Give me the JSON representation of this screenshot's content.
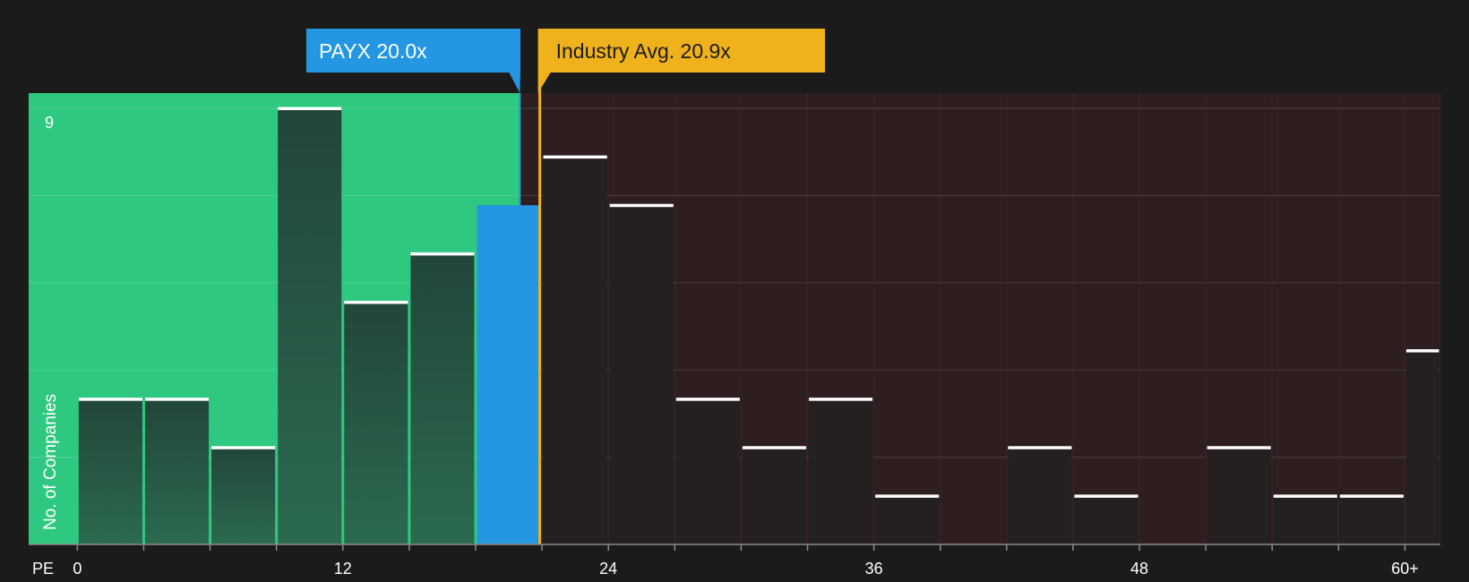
{
  "chart_data": {
    "type": "bar",
    "x_axis_prefix": "PE",
    "xlabel": "",
    "ylabel": "No. of Companies",
    "x_ticks": [
      "0",
      "12",
      "24",
      "36",
      "48",
      "60+"
    ],
    "x_tick_values": [
      0,
      12,
      24,
      36,
      48,
      60
    ],
    "y_tick_labels": [
      "9"
    ],
    "xlim": [
      -2.2,
      61.6
    ],
    "ylim": [
      0,
      9.3
    ],
    "bin_width": 3,
    "bins": [
      {
        "start": 0,
        "count": 3
      },
      {
        "start": 3,
        "count": 3
      },
      {
        "start": 6,
        "count": 2
      },
      {
        "start": 9,
        "count": 9
      },
      {
        "start": 12,
        "count": 5
      },
      {
        "start": 15,
        "count": 6
      },
      {
        "start": 18,
        "count": 7
      },
      {
        "start": 21,
        "count": 8
      },
      {
        "start": 24,
        "count": 7
      },
      {
        "start": 27,
        "count": 3
      },
      {
        "start": 30,
        "count": 2
      },
      {
        "start": 33,
        "count": 3
      },
      {
        "start": 36,
        "count": 1
      },
      {
        "start": 39,
        "count": 0
      },
      {
        "start": 42,
        "count": 2
      },
      {
        "start": 45,
        "count": 1
      },
      {
        "start": 48,
        "count": 0
      },
      {
        "start": 51,
        "count": 2
      },
      {
        "start": 54,
        "count": 1
      },
      {
        "start": 57,
        "count": 1
      },
      {
        "start": 60,
        "count": 4
      }
    ],
    "highlight_bin_start": 18,
    "company": {
      "label": "PAYX 20.0x",
      "value": 20.0
    },
    "industry": {
      "label": "Industry Avg. 20.9x",
      "value": 20.9
    },
    "grid": true,
    "colors": {
      "background": "#1b1b1b",
      "below_zone": "#2fc880",
      "above_zone": "#2e1e1f",
      "bar_below": "#24493a",
      "bar_above": "#252020",
      "company": "#2496e2",
      "industry": "#efb21c",
      "bar_cap": "#ffffff"
    }
  }
}
